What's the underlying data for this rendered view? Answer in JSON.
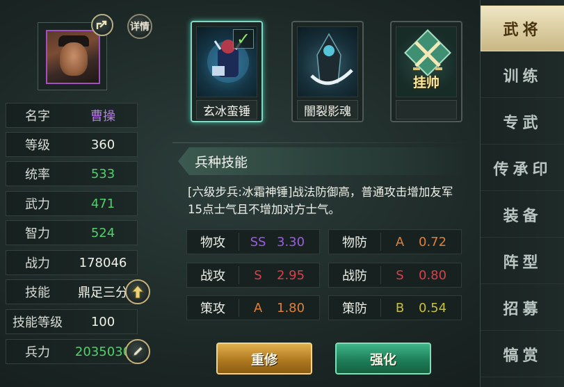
{
  "general": {
    "share_icon": "share-icon",
    "detail_label": "详情",
    "stats": [
      {
        "label": "名字",
        "value": "曹操",
        "color": "#b97ce8"
      },
      {
        "label": "等级",
        "value": "360",
        "color": "#f2f2ea"
      },
      {
        "label": "统率",
        "value": "533",
        "color": "#52d16a"
      },
      {
        "label": "武力",
        "value": "471",
        "color": "#52d16a"
      },
      {
        "label": "智力",
        "value": "524",
        "color": "#52d16a"
      },
      {
        "label": "战力",
        "value": "178046",
        "color": "#f2f2ea"
      },
      {
        "label": "技能",
        "value": "鼎足三分",
        "color": "#f2f2ea"
      },
      {
        "label": "技能等级",
        "value": "100",
        "color": "#f2f2ea"
      },
      {
        "label": "兵力",
        "value": "2035030",
        "color": "#52d16a"
      }
    ]
  },
  "troops": {
    "cards": [
      {
        "name": "玄冰蛮锤",
        "selected": true
      },
      {
        "name": "闇裂影魂",
        "selected": false
      },
      {
        "name": "",
        "selected": false,
        "overlay": "挂帅"
      }
    ]
  },
  "skill": {
    "title": "兵种技能",
    "description": "[六级步兵:冰霜神锤]战法防御高，普通攻击增加友军15点士气且不增加对方士气。",
    "attributes": [
      {
        "name": "物攻",
        "grade": "SS",
        "value": "3.30",
        "grade_color": "#9b5de0",
        "value_color": "#9b5de0"
      },
      {
        "name": "物防",
        "grade": "A",
        "value": "0.72",
        "grade_color": "#e08038",
        "value_color": "#e08038"
      },
      {
        "name": "战攻",
        "grade": "S",
        "value": "2.95",
        "grade_color": "#d8404a",
        "value_color": "#d8404a"
      },
      {
        "name": "战防",
        "grade": "S",
        "value": "0.80",
        "grade_color": "#d8404a",
        "value_color": "#d8404a"
      },
      {
        "name": "策攻",
        "grade": "A",
        "value": "1.80",
        "grade_color": "#e08038",
        "value_color": "#e08038"
      },
      {
        "name": "策防",
        "grade": "B",
        "value": "0.54",
        "grade_color": "#c8c038",
        "value_color": "#c8c038"
      }
    ]
  },
  "actions": {
    "reforge_label": "重修",
    "enhance_label": "强化"
  },
  "tabs": [
    {
      "label": "武将",
      "active": true
    },
    {
      "label": "训练",
      "active": false
    },
    {
      "label": "专武",
      "active": false
    },
    {
      "label": "传承印",
      "active": false
    },
    {
      "label": "装备",
      "active": false
    },
    {
      "label": "阵型",
      "active": false
    },
    {
      "label": "招募",
      "active": false
    },
    {
      "label": "犒赏",
      "active": false
    }
  ]
}
